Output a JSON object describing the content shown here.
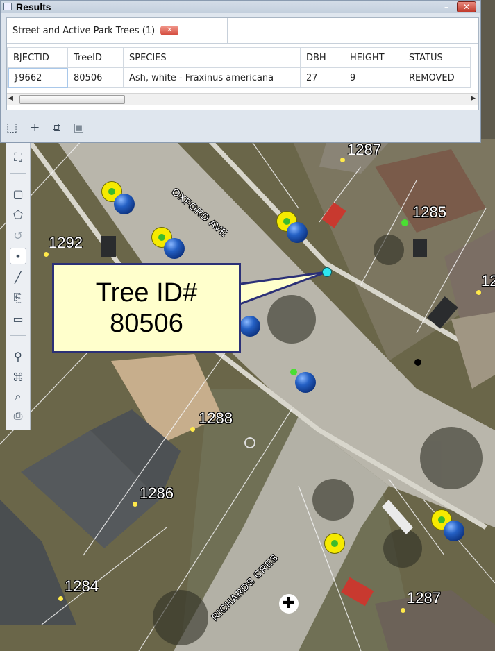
{
  "results_window": {
    "title": "Results",
    "close_label": "✕",
    "minimize_label": "–",
    "tab": {
      "label": "Street and Active Park Trees (1)",
      "close_label": "✕"
    },
    "table": {
      "columns": [
        "BJECTID",
        "TreeID",
        "SPECIES",
        "DBH",
        "HEIGHT",
        "STATUS"
      ],
      "rows": [
        [
          "}9662",
          "80506",
          "Ash, white - Fraxinus americana",
          "27",
          "9",
          "REMOVED"
        ]
      ]
    },
    "bottom_tools": [
      "zoom-extent-icon",
      "add-icon",
      "copy-icon",
      "save-icon"
    ]
  },
  "map": {
    "parcel_labels": [
      "1287",
      "1285",
      "1292",
      "12",
      "1288",
      "1286",
      "1284",
      "1287"
    ],
    "street_labels": [
      "OXFORD AVE",
      "RICHARDS CRES"
    ],
    "callout": {
      "line1": "Tree ID#",
      "line2": "80506"
    },
    "tools": [
      "fullscreen-icon",
      "rectangle-select-icon",
      "polygon-select-icon",
      "undo-icon",
      "point-select-icon",
      "line-icon",
      "export-icon",
      "shape-menu-icon",
      "clear-selection-icon",
      "network-icon",
      "binoculars-icon",
      "print-icon"
    ],
    "colors": {
      "callout_bg": "#ffffcc",
      "callout_border": "#2b3077",
      "tree_marker": "#f6ea00",
      "selected_tree": "#2ee6f0"
    }
  }
}
